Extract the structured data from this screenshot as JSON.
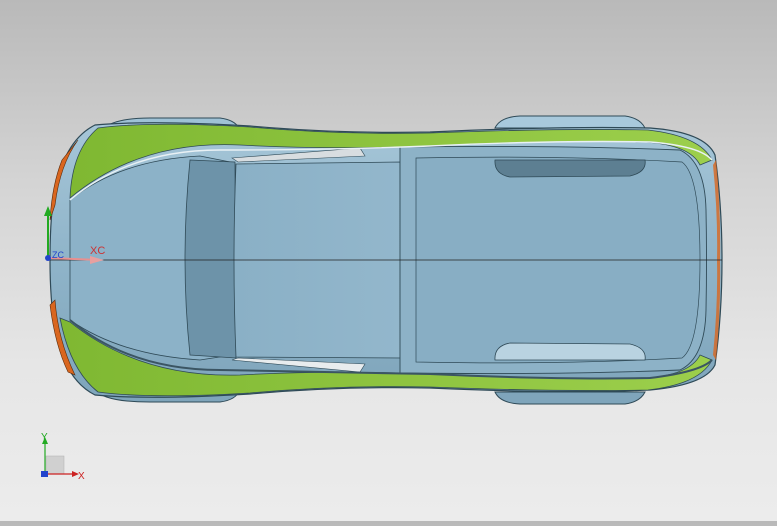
{
  "viewport": {
    "model_name": "car-body-top-view",
    "colors": {
      "background_top": "#b9b9b9",
      "background_bottom": "#ececec",
      "body_blue": "#8fb4c9",
      "body_blue_dark": "#6f95ab",
      "trim_green": "#8cc63f",
      "accent_orange": "#d9661f",
      "outline": "#2f4a57"
    }
  },
  "wcs": {
    "xc_label": "XC",
    "zc_label": "ZC"
  },
  "triad": {
    "x_label": "X",
    "y_label": "Y",
    "x_color": "#cc2222",
    "y_color": "#22aa22",
    "z_color": "#2244cc"
  }
}
